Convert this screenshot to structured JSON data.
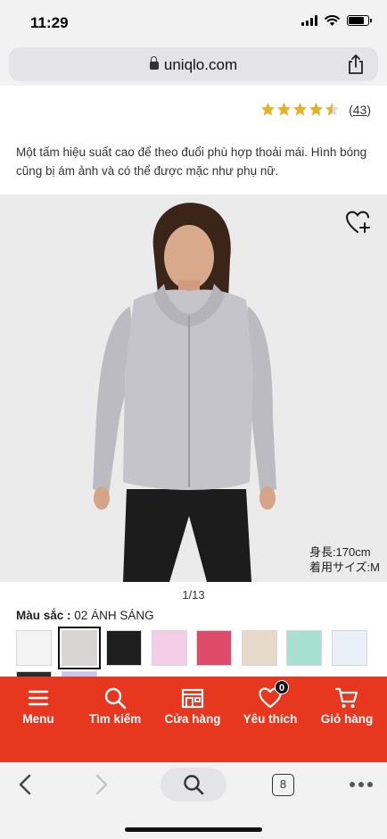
{
  "status_bar": {
    "time": "11:29",
    "battery_level": 0.8
  },
  "browser": {
    "url": "uniqlo.com",
    "tab_count": "8"
  },
  "product": {
    "title_fragment": "...",
    "rating": 4.5,
    "review_count": "43",
    "description": "Một tấm hiệu suất cao để theo đuổi phù hợp thoải mái. Hình bóng cũng bị ám ảnh và có thể được mặc như phụ nữ.",
    "photo_caption_height": "身長:170cm",
    "photo_caption_size": "着用サイズ:M",
    "image_pager": "1/13",
    "color_label": "Màu sắc :",
    "color_value": "02 ÁNH SÁNG",
    "swatches": [
      {
        "color": "#f4f4f4",
        "selected": false
      },
      {
        "color": "#d8d4d4",
        "selected": true
      },
      {
        "color": "#1e1e1e",
        "selected": false
      },
      {
        "color": "#f3cde6",
        "selected": false
      },
      {
        "color": "#de4a6a",
        "selected": false
      },
      {
        "color": "#e6d9c8",
        "selected": false
      },
      {
        "color": "#a8e0cf",
        "selected": false
      },
      {
        "color": "#eaf0f8",
        "selected": false
      }
    ],
    "next_row_colors": [
      "#2a2a2a",
      "#c9c4ee"
    ]
  },
  "site_nav": {
    "items": [
      {
        "label": "Menu",
        "icon": "menu-icon"
      },
      {
        "label": "Tìm kiếm",
        "icon": "search-icon"
      },
      {
        "label": "Cửa hàng",
        "icon": "store-icon"
      },
      {
        "label": "Yêu thích",
        "icon": "heart-icon",
        "badge": "0"
      },
      {
        "label": "Giỏ hàng",
        "icon": "cart-icon"
      }
    ]
  },
  "colors": {
    "brand_red": "#e8371f",
    "star_gold": "#e2b425"
  }
}
